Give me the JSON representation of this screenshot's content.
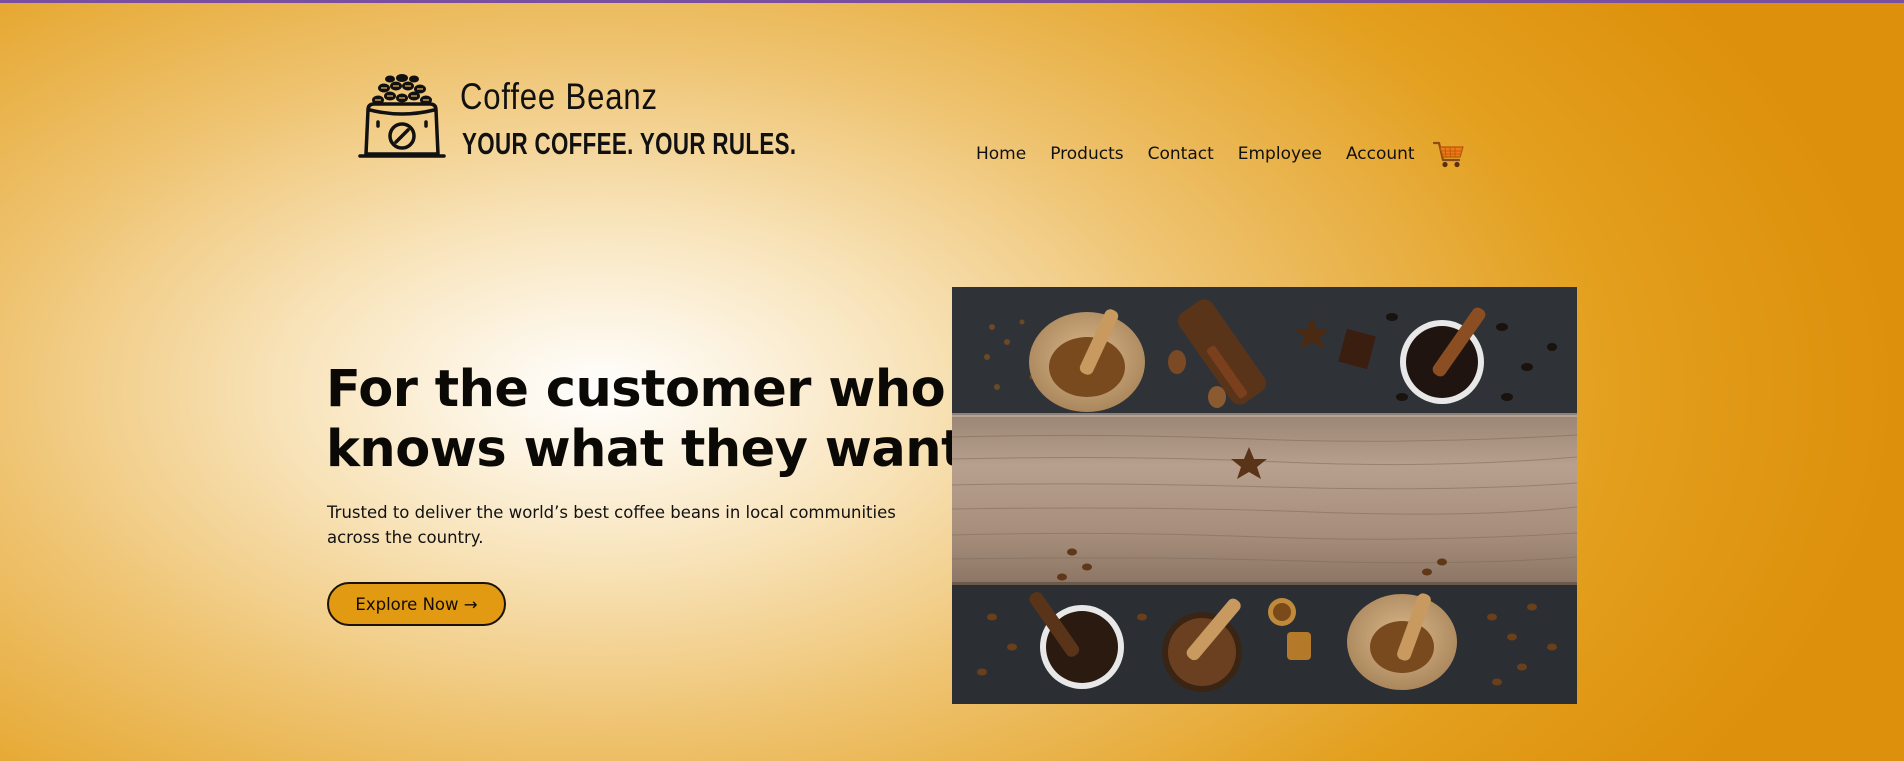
{
  "brand": {
    "name": "Coffee Beanz",
    "tagline": "YOUR COFFEE. YOUR RULES."
  },
  "nav": {
    "items": [
      "Home",
      "Products",
      "Contact",
      "Employee",
      "Account"
    ],
    "cart_icon": "cart-icon"
  },
  "hero": {
    "headline_line1": "For the customer who",
    "headline_line2": "knows what they want.",
    "subtext": "Trusted to deliver the world’s best coffee beans in local communities across the country.",
    "cta_label": "Explore Now →",
    "image_icon": "coffee-flatlay-photo"
  },
  "colors": {
    "accent": "#e19a12",
    "background_edge": "#dd900b",
    "background_center": "#ffffff",
    "top_line": "#7a4fa0",
    "text": "#0b0906"
  }
}
